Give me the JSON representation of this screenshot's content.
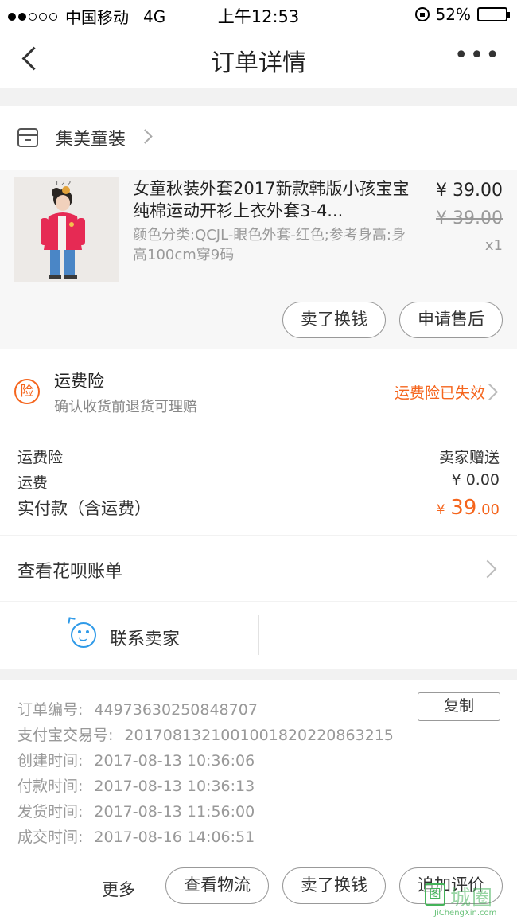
{
  "status_bar": {
    "carrier": "中国移动",
    "network": "4G",
    "time": "上午12:53",
    "battery": "52%",
    "battery_level": 0.52
  },
  "nav": {
    "title": "订单详情",
    "back_icon": "chevron-left-icon",
    "more_icon": "more-dots-icon",
    "more_glyph": "•••"
  },
  "shop": {
    "name": "集美童装",
    "icon": "store-icon"
  },
  "product": {
    "title": "女童秋装外套2017新款韩版小孩宝宝纯棉运动开衫上衣外套3-4...",
    "sku": "颜色分类:QCJL-眼色外套-红色;参考身高:身高100cm穿9码",
    "price": "¥ 39.00",
    "original_price": "¥ 39.00",
    "quantity": "x1",
    "image_caption": "1 2 2",
    "buttons": {
      "sell": "卖了换钱",
      "after_sale": "申请售后"
    }
  },
  "insurance": {
    "badge": "险",
    "title": "运费险",
    "subtitle": "确认收货前退货可理赔",
    "status": "运费险已失效",
    "status_color": "#f5651d"
  },
  "fees": {
    "insurance_label": "运费险",
    "insurance_value": "卖家赠送",
    "shipping_label": "运费",
    "shipping_value": "¥ 0.00",
    "total_label": "实付款（含运费）",
    "total_currency": "¥",
    "total_int": "39",
    "total_dec": ".00"
  },
  "huabei": {
    "label": "查看花呗账单"
  },
  "contact": {
    "label": "联系卖家",
    "icon": "chat-face-icon",
    "icon_color": "#2f9ae8"
  },
  "order_info": {
    "copy_label": "复制",
    "rows": [
      {
        "label": "订单编号:",
        "value": "44973630250848707"
      },
      {
        "label": "支付宝交易号:",
        "value": "2017081321001001820220863215"
      },
      {
        "label": "创建时间:",
        "value": "2017-08-13 10:36:06"
      },
      {
        "label": "付款时间:",
        "value": "2017-08-13 10:36:13"
      },
      {
        "label": "发货时间:",
        "value": "2017-08-13 11:56:00"
      },
      {
        "label": "成交时间:",
        "value": "2017-08-16 14:06:51"
      }
    ]
  },
  "bottom_bar": {
    "more": "更多",
    "logistics": "查看物流",
    "sell": "卖了换钱",
    "review": "追加评价"
  },
  "watermark": {
    "box_char": "图",
    "text": "城圈",
    "sub": "JiChengXin.com",
    "color": "#45b35a"
  }
}
